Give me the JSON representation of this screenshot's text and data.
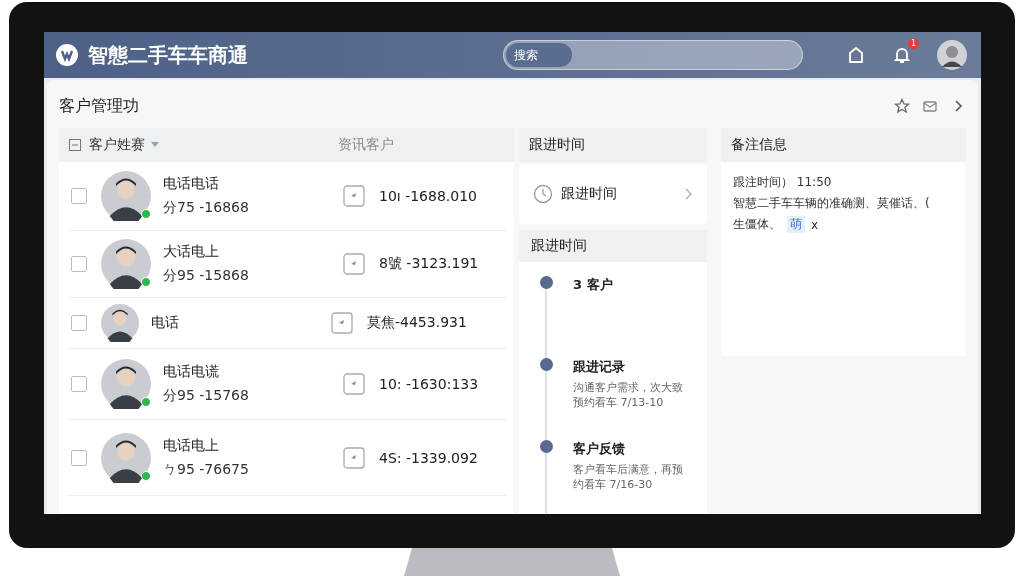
{
  "app": {
    "title": "智態二手车车商通",
    "search": {
      "placeholder": "搜索"
    },
    "notifications": {
      "count": "1"
    }
  },
  "page": {
    "title": "客户管理功"
  },
  "customer_list": {
    "columns": [
      "客户姓赛",
      "资讯客户"
    ],
    "rows": [
      {
        "name": "电话电话",
        "code": "分75 -16868",
        "phone": "10ı -1688.010",
        "checked": false,
        "online": true
      },
      {
        "name": "大话电上",
        "code": "分95 -15868",
        "phone": "8號 -3123.191",
        "checked": false,
        "online": true
      },
      {
        "name": "电话",
        "phone": "莫焦-4453.931",
        "checked": false,
        "online": false
      },
      {
        "name": "电话电谎",
        "code": "分95 -15768",
        "phone": "10: -1630:133",
        "checked": false,
        "online": true
      },
      {
        "name": "电话电上",
        "code": "ㄅ95 -76675",
        "phone": "4S: -1339.092",
        "checked": false,
        "online": true
      }
    ]
  },
  "follow_up": {
    "title": "跟进时间",
    "link": "跟进时间",
    "timeline_title": "跟进时间",
    "timeline": [
      {
        "title": "3 客户"
      },
      {
        "title": "跟进记录",
        "text": "沟通客户需求，次大致预约看车 7/13-10"
      },
      {
        "title": "客户反馈",
        "text": "客户看车后满意，再预约看车 7/16-30"
      }
    ]
  },
  "notes": {
    "title": "备注信息",
    "lines": [
      "跟注时间） 11:50",
      "智慧二手车车辆的准确测、莫催话、("
    ],
    "last_line": "生僵体、",
    "tag": "萌",
    "tag_close": "x"
  }
}
